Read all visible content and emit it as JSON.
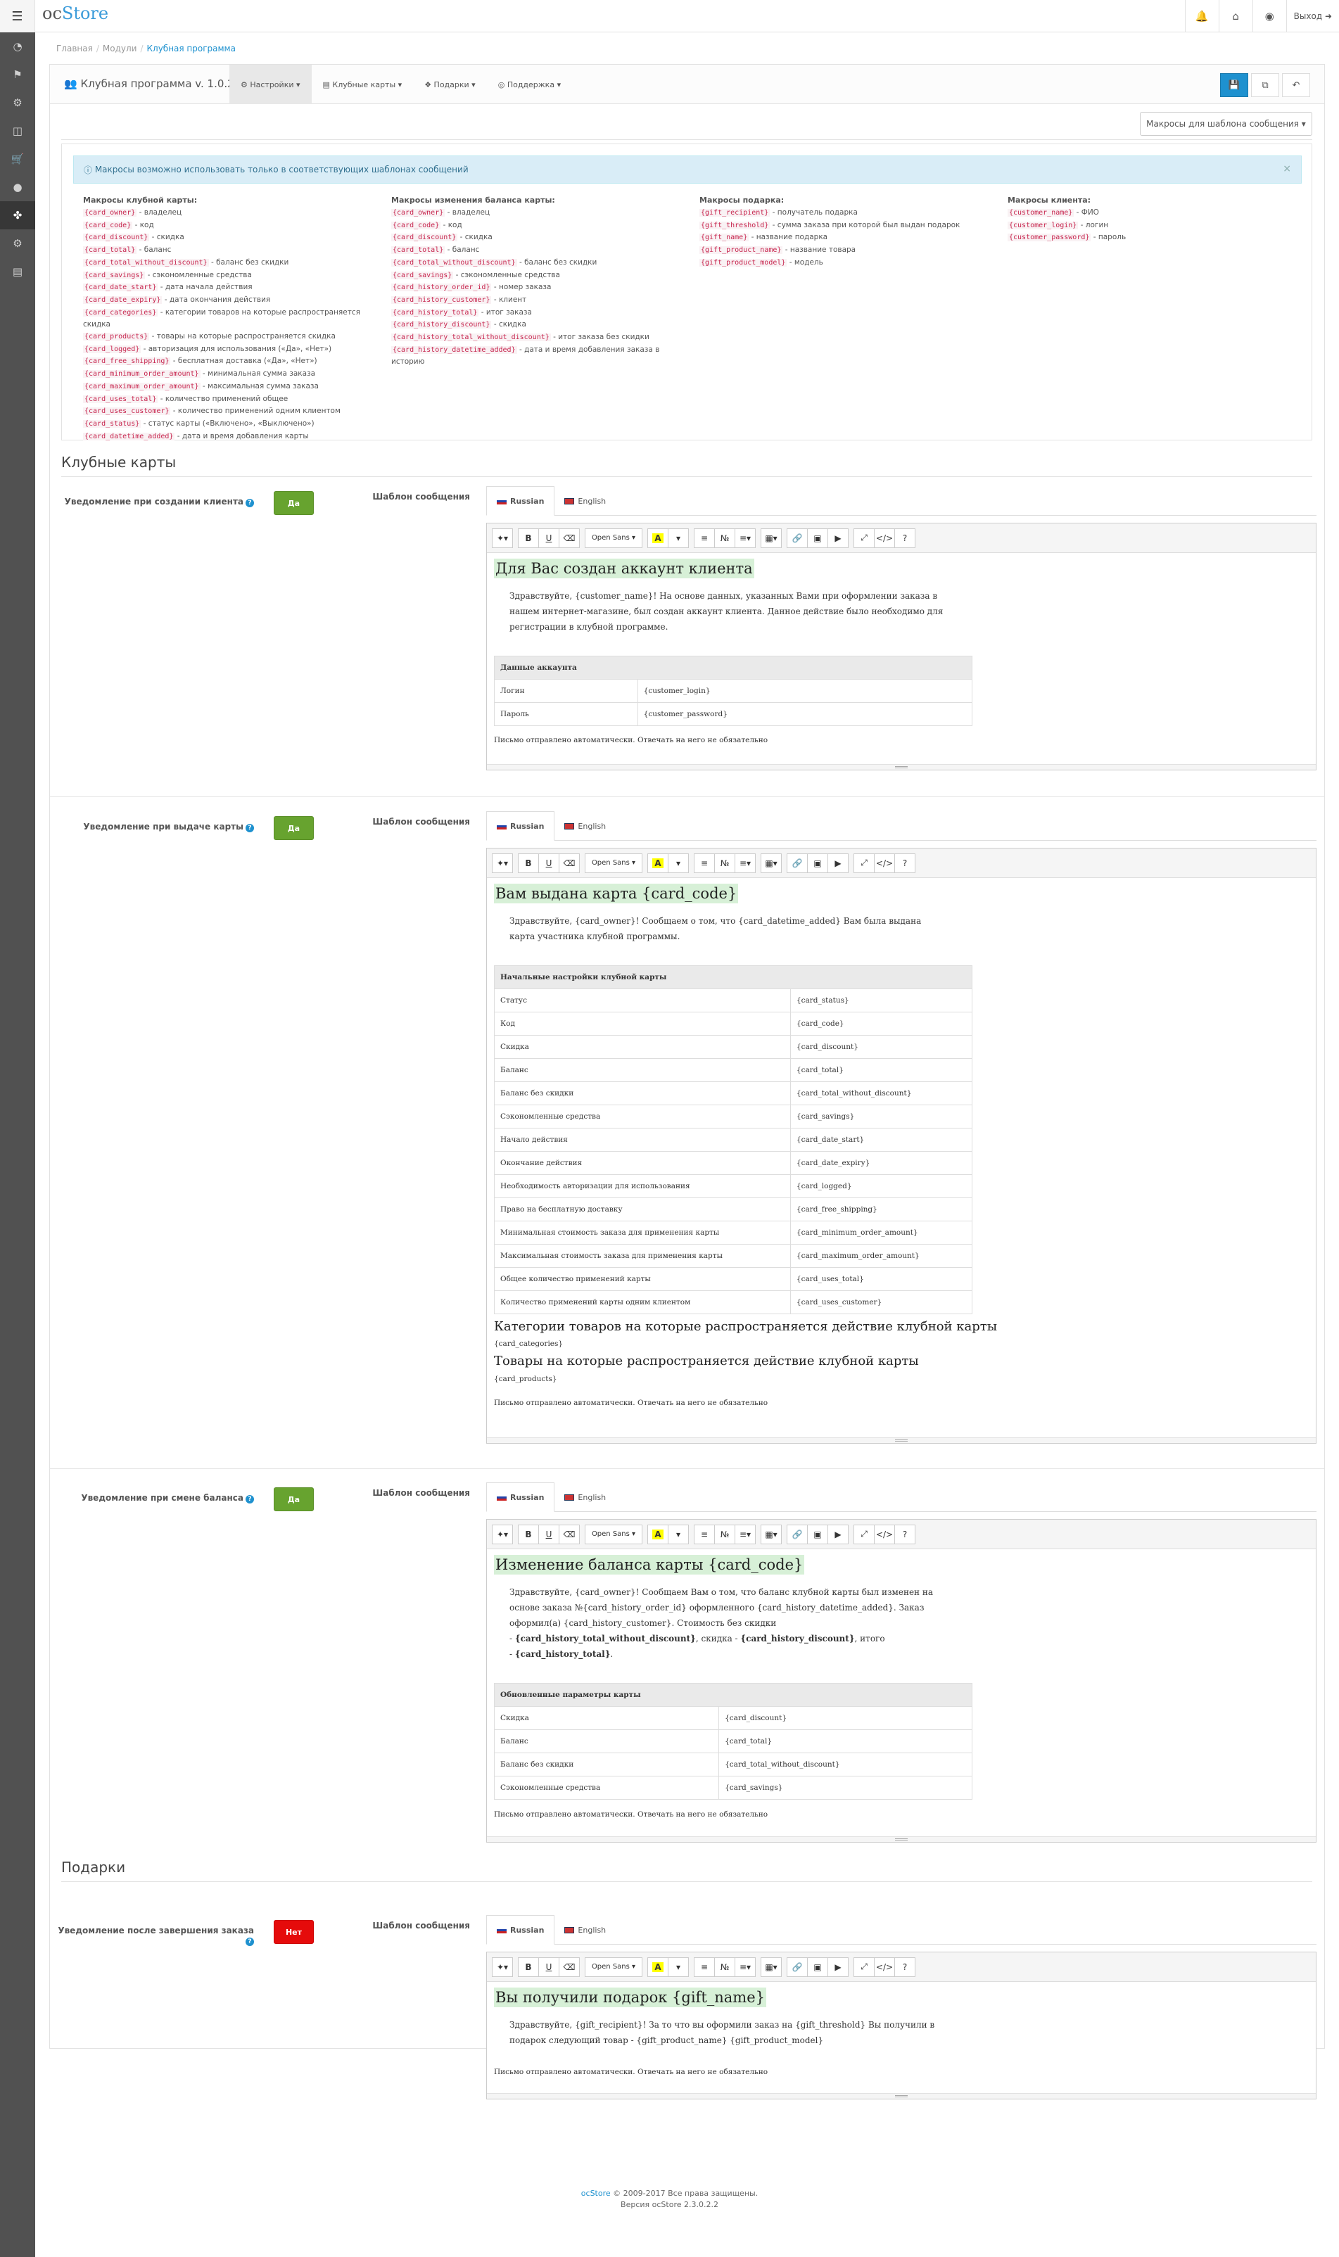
{
  "topbar": {
    "logo_prefix": "oc",
    "logo_main": "Store",
    "logout_label": "Выход"
  },
  "breadcrumb": [
    "Главная",
    "Модули",
    "Клубная программа"
  ],
  "panel": {
    "title": "Клубная программа v. 1.0.2",
    "menus": [
      "Настройки",
      "Клубные карты",
      "Подарки",
      "Поддержка"
    ],
    "macro_button": "Макросы для шаблона сообщения"
  },
  "alert": "Макросы возможно использовать только в соответствующих шаблонах сообщений",
  "macros": {
    "card": {
      "title": "Макросы клубной карты:",
      "items": [
        {
          "code": "{card_owner}",
          "desc": " - владелец"
        },
        {
          "code": "{card_code}",
          "desc": " - код"
        },
        {
          "code": "{card_discount}",
          "desc": " - скидка"
        },
        {
          "code": "{card_total}",
          "desc": " - баланс"
        },
        {
          "code": "{card_total_without_discount}",
          "desc": " - баланс без скидки"
        },
        {
          "code": "{card_savings}",
          "desc": " - сэкономленные средства"
        },
        {
          "code": "{card_date_start}",
          "desc": " - дата начала действия"
        },
        {
          "code": "{card_date_expiry}",
          "desc": " - дата окончания действия"
        },
        {
          "code": "{card_categories}",
          "desc": " - категории товаров на которые распространяется скидка"
        },
        {
          "code": "{card_products}",
          "desc": " - товары на которые распространяется скидка"
        },
        {
          "code": "{card_logged}",
          "desc": " - авторизация для использования («Да», «Нет»)"
        },
        {
          "code": "{card_free_shipping}",
          "desc": " - бесплатная доставка («Да», «Нет»)"
        },
        {
          "code": "{card_minimum_order_amount}",
          "desc": " - минимальная сумма заказа"
        },
        {
          "code": "{card_maximum_order_amount}",
          "desc": " - максимальная сумма заказа"
        },
        {
          "code": "{card_uses_total}",
          "desc": " - количество применений общее"
        },
        {
          "code": "{card_uses_customer}",
          "desc": " - количество применений одним клиентом"
        },
        {
          "code": "{card_status}",
          "desc": " - статус карты («Включено», «Выключено»)"
        },
        {
          "code": "{card_datetime_added}",
          "desc": " - дата и время добавления карты"
        }
      ]
    },
    "balance": {
      "title": "Макросы изменения баланса карты:",
      "items": [
        {
          "code": "{card_owner}",
          "desc": " - владелец"
        },
        {
          "code": "{card_code}",
          "desc": " - код"
        },
        {
          "code": "{card_discount}",
          "desc": " - скидка"
        },
        {
          "code": "{card_total}",
          "desc": " - баланс"
        },
        {
          "code": "{card_total_without_discount}",
          "desc": " - баланс без скидки"
        },
        {
          "code": "{card_savings}",
          "desc": " - сэкономленные средства"
        },
        {
          "code": "{card_history_order_id}",
          "desc": " - номер заказа"
        },
        {
          "code": "{card_history_customer}",
          "desc": " - клиент"
        },
        {
          "code": "{card_history_total}",
          "desc": " - итог заказа"
        },
        {
          "code": "{card_history_discount}",
          "desc": " - скидка"
        },
        {
          "code": "{card_history_total_without_discount}",
          "desc": " - итог заказа без скидки"
        },
        {
          "code": "{card_history_datetime_added}",
          "desc": " - дата и время добавления заказа в историю"
        }
      ]
    },
    "gift": {
      "title": "Макросы подарка:",
      "items": [
        {
          "code": "{gift_recipient}",
          "desc": " - получатель подарка"
        },
        {
          "code": "{gift_threshold}",
          "desc": " - сумма заказа при которой был выдан подарок"
        },
        {
          "code": "{gift_name}",
          "desc": " - название подарка"
        },
        {
          "code": "{gift_product_name}",
          "desc": " - название товара"
        },
        {
          "code": "{gift_product_model}",
          "desc": " - модель"
        }
      ]
    },
    "customer": {
      "title": "Макросы клиента:",
      "items": [
        {
          "code": "{customer_name}",
          "desc": " - ФИО"
        },
        {
          "code": "{customer_login}",
          "desc": " - логин"
        },
        {
          "code": "{customer_password}",
          "desc": " - пароль"
        }
      ]
    }
  },
  "sections": {
    "cards": "Клубные карты",
    "gifts": "Подарки"
  },
  "common": {
    "template_label": "Шаблон сообщения",
    "tab_ru": "Russian",
    "tab_en": "English",
    "font_select": "Open Sans",
    "footer_note": "Письмо отправлено автоматически. Отвечать на него не обязательно"
  },
  "block1": {
    "label": "Уведомление при создании клиента",
    "toggle": "Да",
    "heading": "Для Вас создан аккаунт клиента",
    "text": "Здравствуйте, {customer_name}! На основе данных, указанных Вами при оформлении заказа в нашем интернет-магазине, был создан аккаунт клиента. Данное действие было необходимо для регистрации в клубной программе.",
    "table_header": "Данные аккаунта",
    "rows": [
      [
        "Логин",
        "{customer_login}"
      ],
      [
        "Пароль",
        "{customer_password}"
      ]
    ]
  },
  "block2": {
    "label": "Уведомление при выдаче карты",
    "toggle": "Да",
    "heading": "Вам выдана карта {card_code}",
    "text": "Здравствуйте, {card_owner}! Сообщаем о том, что {card_datetime_added} Вам была выдана карта участника клубной программы.",
    "table_header": "Начальные настройки клубной карты",
    "rows": [
      [
        "Статус",
        "{card_status}"
      ],
      [
        "Код",
        "{card_code}"
      ],
      [
        "Скидка",
        "{card_discount}"
      ],
      [
        "Баланс",
        "{card_total}"
      ],
      [
        "Баланс без скидки",
        "{card_total_without_discount}"
      ],
      [
        "Сэкономленные средства",
        "{card_savings}"
      ],
      [
        "Начало действия",
        "{card_date_start}"
      ],
      [
        "Окончание действия",
        "{card_date_expiry}"
      ],
      [
        "Необходимость авторизации для использования",
        "{card_logged}"
      ],
      [
        "Право на бесплатную доставку",
        "{card_free_shipping}"
      ],
      [
        "Минимальная стоимость заказа для применения карты",
        "{card_minimum_order_amount}"
      ],
      [
        "Максимальная стоимость заказа для применения карты",
        "{card_maximum_order_amount}"
      ],
      [
        "Общее количество применений карты",
        "{card_uses_total}"
      ],
      [
        "Количество применений карты одним клиентом",
        "{card_uses_customer}"
      ]
    ],
    "cat_heading": "Категории товаров на которые распространяется действие клубной карты",
    "cat_macro": "{card_categories}",
    "prod_heading": "Товары на которые распространяется действие клубной карты",
    "prod_macro": "{card_products}"
  },
  "block3": {
    "label": "Уведомление при смене баланса",
    "toggle": "Да",
    "heading": "Изменение баланса карты {card_code}",
    "text_a": "Здравствуйте, {card_owner}! Сообщаем Вам о том, что баланс клубной карты был изменен на основе заказа №{card_history_order_id} оформленного {card_history_datetime_added}. Заказ оформил(а) {card_history_customer}. Стоимость без скидки",
    "dash1": "- ",
    "bold1": "{card_history_total_without_discount}",
    "mid": ", скидка - ",
    "bold2": "{card_history_discount}",
    "mid2": ", итого",
    "dash2": "- ",
    "bold3": "{card_history_total}",
    "end": ".",
    "table_header": "Обновленные параметры карты",
    "rows": [
      [
        "Скидка",
        "{card_discount}"
      ],
      [
        "Баланс",
        "{card_total}"
      ],
      [
        "Баланс без скидки",
        "{card_total_without_discount}"
      ],
      [
        "Сэкономленные средства",
        "{card_savings}"
      ]
    ]
  },
  "block4": {
    "label": "Уведомление после завершения заказа",
    "toggle": "Нет",
    "heading": "Вы получили подарок {gift_name}",
    "text": "Здравствуйте, {gift_recipient}! За то что вы оформили заказ на {gift_threshold} Вы получили в подарок следующий товар - {gift_product_name} {gift_product_model}"
  },
  "footer": {
    "brand": "ocStore",
    "copy": " © 2009-2017 Все права защищены.",
    "version": "Версия ocStore 2.3.0.2.2"
  }
}
